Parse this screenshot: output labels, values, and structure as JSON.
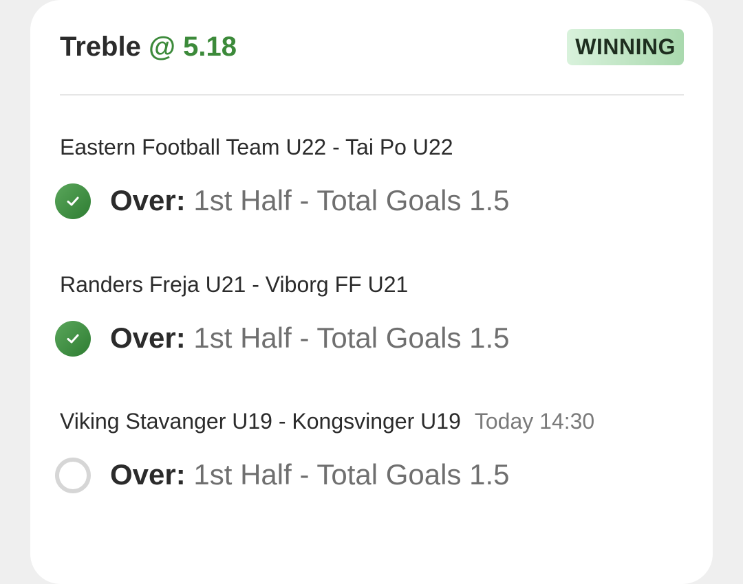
{
  "header": {
    "bet_type": "Treble",
    "odds": "@ 5.18",
    "status_badge": "WINNING"
  },
  "legs": [
    {
      "match": "Eastern Football Team U22 - Tai Po U22",
      "time": "",
      "selection_label": "Over:",
      "market": "1st Half - Total Goals 1.5",
      "status": "won",
      "status_icon": "check-icon"
    },
    {
      "match": "Randers Freja U21 - Viborg FF U21",
      "time": "",
      "selection_label": "Over:",
      "market": "1st Half - Total Goals 1.5",
      "status": "won",
      "status_icon": "check-icon"
    },
    {
      "match": "Viking Stavanger U19 - Kongsvinger U19",
      "time": "Today 14:30",
      "selection_label": "Over:",
      "market": "1st Half - Total Goals 1.5",
      "status": "pending",
      "status_icon": "pending-circle-icon"
    }
  ],
  "colors": {
    "accent_green": "#3c8a3a",
    "badge_bg": "#c6e9ca",
    "pending_grey": "#d6d6d6"
  }
}
